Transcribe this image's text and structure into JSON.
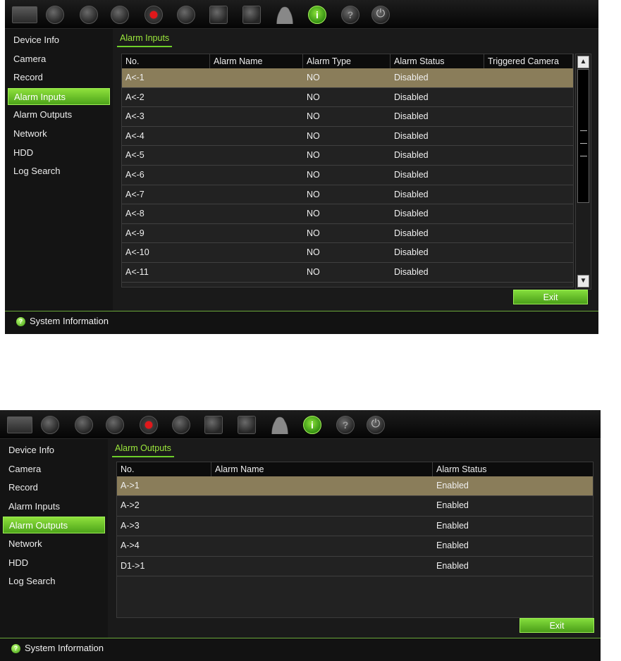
{
  "toolbar": {
    "icons": [
      "monitor-icon",
      "camera-icon",
      "ptz-icon",
      "network-icon",
      "record-icon",
      "alarm-icon",
      "hdd-icon",
      "disk-icon",
      "user-icon",
      "info-icon",
      "help-icon",
      "power-icon"
    ],
    "info_glyph": "i",
    "help_glyph": "?",
    "power_glyph": "⏻"
  },
  "sidebar_items": [
    "Device Info",
    "Camera",
    "Record",
    "Alarm Inputs",
    "Alarm Outputs",
    "Network",
    "HDD",
    "Log Search"
  ],
  "statusbar": {
    "label": "System Information",
    "icon_glyph": "?"
  },
  "screen_inputs": {
    "active_menu": "Alarm Inputs",
    "tab": "Alarm Inputs",
    "columns": [
      "No.",
      "Alarm Name",
      "Alarm Type",
      "Alarm Status",
      "Triggered Camera"
    ],
    "rows": [
      {
        "no": "A<-1",
        "name": "",
        "type": "NO",
        "status": "Disabled",
        "camera": "",
        "selected": true
      },
      {
        "no": "A<-2",
        "name": "",
        "type": "NO",
        "status": "Disabled",
        "camera": ""
      },
      {
        "no": "A<-3",
        "name": "",
        "type": "NO",
        "status": "Disabled",
        "camera": ""
      },
      {
        "no": "A<-4",
        "name": "",
        "type": "NO",
        "status": "Disabled",
        "camera": ""
      },
      {
        "no": "A<-5",
        "name": "",
        "type": "NO",
        "status": "Disabled",
        "camera": ""
      },
      {
        "no": "A<-6",
        "name": "",
        "type": "NO",
        "status": "Disabled",
        "camera": ""
      },
      {
        "no": "A<-7",
        "name": "",
        "type": "NO",
        "status": "Disabled",
        "camera": ""
      },
      {
        "no": "A<-8",
        "name": "",
        "type": "NO",
        "status": "Disabled",
        "camera": ""
      },
      {
        "no": "A<-9",
        "name": "",
        "type": "NO",
        "status": "Disabled",
        "camera": ""
      },
      {
        "no": "A<-10",
        "name": "",
        "type": "NO",
        "status": "Disabled",
        "camera": ""
      },
      {
        "no": "A<-11",
        "name": "",
        "type": "NO",
        "status": "Disabled",
        "camera": ""
      }
    ],
    "scroll_up_glyph": "▲",
    "scroll_down_glyph": "▼",
    "exit_label": "Exit"
  },
  "screen_outputs": {
    "active_menu": "Alarm Outputs",
    "tab": "Alarm Outputs",
    "columns": [
      "No.",
      "Alarm Name",
      "Alarm Status"
    ],
    "rows": [
      {
        "no": "A->1",
        "name": "",
        "status": "Enabled",
        "selected": true
      },
      {
        "no": "A->2",
        "name": "",
        "status": "Enabled"
      },
      {
        "no": "A->3",
        "name": "",
        "status": "Enabled"
      },
      {
        "no": "A->4",
        "name": "",
        "status": "Enabled"
      },
      {
        "no": "D1->1",
        "name": "",
        "status": "Enabled"
      }
    ],
    "exit_label": "Exit"
  },
  "colors": {
    "accent": "#6ed02a",
    "selected_row": "#8a7d5a",
    "background": "#0c0c0c"
  }
}
